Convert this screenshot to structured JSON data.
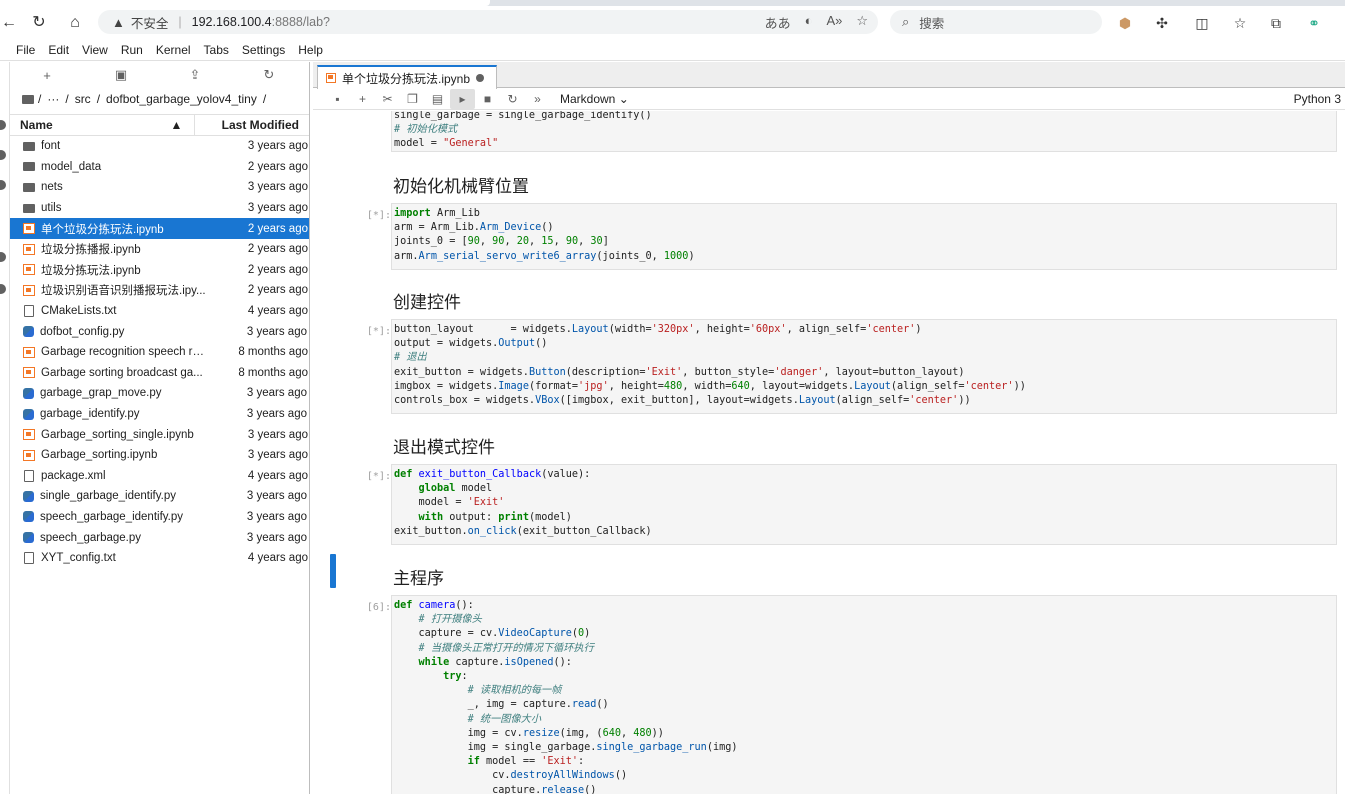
{
  "browser": {
    "insecure_label": "不安全",
    "url_host": "192.168.100.4",
    "url_path": ":8888/lab?",
    "search_placeholder": "搜索"
  },
  "menu": [
    "File",
    "Edit",
    "View",
    "Run",
    "Kernel",
    "Tabs",
    "Settings",
    "Help"
  ],
  "filebrowser": {
    "breadcrumb": [
      "/",
      "···",
      "/",
      "src",
      "/",
      "dofbot_garbage_yolov4_tiny",
      "/"
    ],
    "header_name": "Name",
    "header_modified": "Last Modified",
    "files": [
      {
        "name": "font",
        "type": "folder",
        "modified": "3 years ago"
      },
      {
        "name": "model_data",
        "type": "folder",
        "modified": "2 years ago"
      },
      {
        "name": "nets",
        "type": "folder",
        "modified": "3 years ago"
      },
      {
        "name": "utils",
        "type": "folder",
        "modified": "3 years ago"
      },
      {
        "name": "单个垃圾分拣玩法.ipynb",
        "type": "notebook",
        "modified": "2 years ago",
        "selected": true
      },
      {
        "name": "垃圾分拣播报.ipynb",
        "type": "notebook",
        "modified": "2 years ago"
      },
      {
        "name": "垃圾分拣玩法.ipynb",
        "type": "notebook",
        "modified": "2 years ago"
      },
      {
        "name": "垃圾识别语音识别播报玩法.ipy...",
        "type": "notebook",
        "modified": "2 years ago"
      },
      {
        "name": "CMakeLists.txt",
        "type": "file",
        "modified": "4 years ago"
      },
      {
        "name": "dofbot_config.py",
        "type": "python",
        "modified": "3 years ago"
      },
      {
        "name": "Garbage recognition speech re...",
        "type": "notebook",
        "modified": "8 months ago"
      },
      {
        "name": "Garbage sorting broadcast ga...",
        "type": "notebook",
        "modified": "8 months ago"
      },
      {
        "name": "garbage_grap_move.py",
        "type": "python",
        "modified": "3 years ago"
      },
      {
        "name": "garbage_identify.py",
        "type": "python",
        "modified": "3 years ago"
      },
      {
        "name": "Garbage_sorting_single.ipynb",
        "type": "notebook",
        "modified": "3 years ago"
      },
      {
        "name": "Garbage_sorting.ipynb",
        "type": "notebook",
        "modified": "3 years ago"
      },
      {
        "name": "package.xml",
        "type": "file",
        "modified": "4 years ago"
      },
      {
        "name": "single_garbage_identify.py",
        "type": "python",
        "modified": "3 years ago"
      },
      {
        "name": "speech_garbage_identify.py",
        "type": "python",
        "modified": "3 years ago"
      },
      {
        "name": "speech_garbage.py",
        "type": "python",
        "modified": "3 years ago"
      },
      {
        "name": "XYT_config.txt",
        "type": "file",
        "modified": "4 years ago"
      }
    ]
  },
  "notebook": {
    "tab_title": "单个垃圾分拣玩法.ipynb",
    "cell_type": "Markdown",
    "kernel": "Python 3",
    "headings": {
      "h1": "初始化机械臂位置",
      "h2": "创建控件",
      "h3": "退出模式控件",
      "h4": "主程序"
    },
    "prompts": {
      "p1": "[*]:",
      "p2": "[*]:",
      "p3": "[*]:",
      "p4": "[6]:"
    }
  },
  "colors": {
    "accent": "#1976d2",
    "notebook_icon": "#f37726",
    "python_icon": "#3572a5"
  }
}
